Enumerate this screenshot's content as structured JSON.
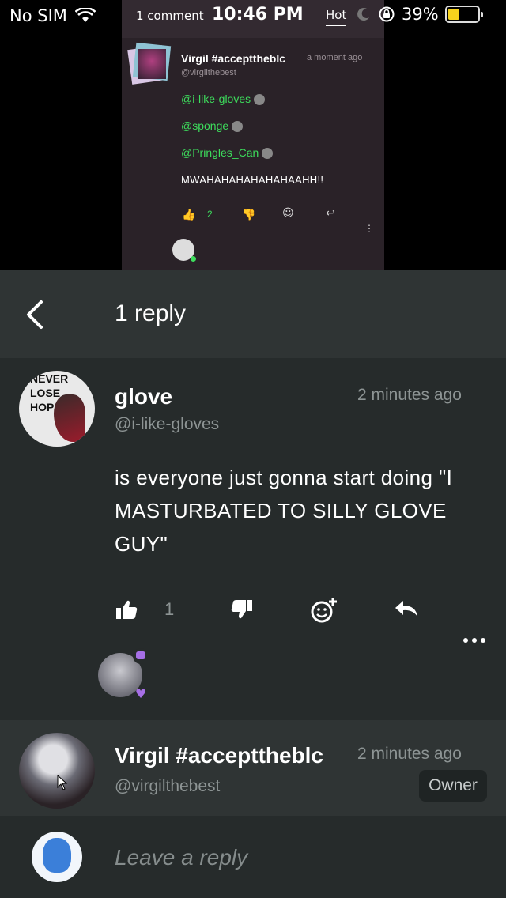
{
  "status_bar": {
    "carrier": "No SIM",
    "time": "10:46 PM",
    "battery": "39%",
    "battery_level": 0.39
  },
  "video_overlay": {
    "comment_count": "1 comment",
    "sort_tab": "Hot"
  },
  "video_comment": {
    "name": "Virgil #accepttheblc",
    "handle": "@virgilthebest",
    "time": "a moment ago",
    "mentions": [
      "@i-like-gloves",
      "@sponge",
      "@Pringles_Can"
    ],
    "text": "MWAHAHAHAHAHAHAAHH!!",
    "like_count": "2"
  },
  "header": {
    "title": "1 reply"
  },
  "comment": {
    "name": "glove",
    "handle": "@i-like-gloves",
    "time": "2 minutes ago",
    "text": "is everyone just gonna start doing \"I MASTURBATED TO SILLY GLOVE GUY\"",
    "like_count": "1",
    "avatar_text": [
      "NEVER",
      "LOSE",
      "HOPE"
    ]
  },
  "owner_reply": {
    "name": "Virgil #accepttheblc",
    "handle": "@virgilthebest",
    "time": "2 minutes ago",
    "badge": "Owner"
  },
  "reply_input": {
    "placeholder": "Leave a reply"
  },
  "colors": {
    "accent_green": "#3ddc5c",
    "accent_purple": "#a66fe6",
    "panel_dark": "#262b2b",
    "panel_light": "#2f3434"
  }
}
